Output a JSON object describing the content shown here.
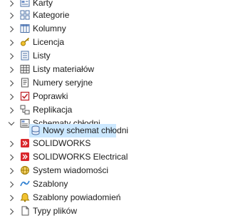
{
  "tree": {
    "items": [
      {
        "label": "Karty",
        "icon": "cards-icon"
      },
      {
        "label": "Kategorie",
        "icon": "categories-icon"
      },
      {
        "label": "Kolumny",
        "icon": "columns-icon"
      },
      {
        "label": "Licencja",
        "icon": "license-icon"
      },
      {
        "label": "Listy",
        "icon": "lists-icon"
      },
      {
        "label": "Listy materiałów",
        "icon": "bill-of-materials-icon"
      },
      {
        "label": "Numery seryjne",
        "icon": "serial-numbers-icon"
      },
      {
        "label": "Poprawki",
        "icon": "revisions-icon"
      },
      {
        "label": "Replikacja",
        "icon": "replication-icon"
      },
      {
        "label": "Schematy chłodni",
        "icon": "cold-storage-schemes-icon",
        "expanded": true
      },
      {
        "label": "Nowy schemat chłodni",
        "icon": "new-scheme-icon",
        "selected": true
      },
      {
        "label": "SOLIDWORKS",
        "icon": "solidworks-icon"
      },
      {
        "label": "SOLIDWORKS Electrical",
        "icon": "solidworks-electrical-icon"
      },
      {
        "label": "System wiadomości",
        "icon": "messages-icon"
      },
      {
        "label": "Szablony",
        "icon": "templates-icon"
      },
      {
        "label": "Szablony powiadomień",
        "icon": "notification-templates-icon"
      },
      {
        "label": "Typy plików",
        "icon": "file-types-icon"
      }
    ]
  },
  "colors": {
    "selection": "#cce8ff",
    "text": "#1a1a1a"
  }
}
